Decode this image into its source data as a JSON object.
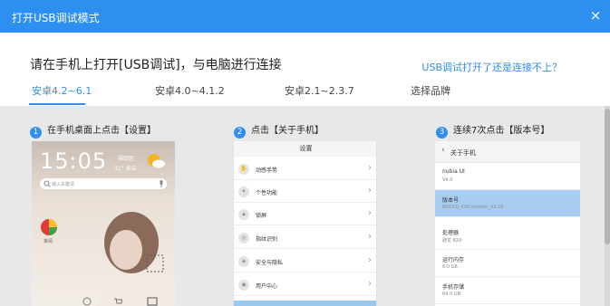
{
  "window": {
    "title": "打开USB调试模式",
    "close_symbol": "×"
  },
  "header": {
    "headline": "请在手机上打开[USB调试]，与电脑进行连接",
    "help_link": "USB调试打开了还是连接不上？"
  },
  "tabs": [
    {
      "label": "安卓4.2~6.1",
      "active": true
    },
    {
      "label": "安卓4.0~4.1.2",
      "active": false
    },
    {
      "label": "安卓2.1~2.3.7",
      "active": false
    },
    {
      "label": "选择品牌",
      "active": false
    }
  ],
  "steps": [
    {
      "num": "1",
      "text": "在手机桌面上点击【设置】"
    },
    {
      "num": "2",
      "text": "点击【关于手机】"
    },
    {
      "num": "3",
      "text": "连续7次点击【版本号】"
    }
  ],
  "phone1": {
    "time": "15:05",
    "city": "福田区",
    "weather": "31°  多云",
    "search_placeholder": "输入关键词",
    "app_label": "掌阅"
  },
  "phone2": {
    "header": "设置",
    "rows": [
      {
        "label": "动感手势"
      },
      {
        "label": "个性功能"
      },
      {
        "label": "锁屏"
      },
      {
        "label": "指纹识别"
      },
      {
        "label": "安全与隐私"
      },
      {
        "label": "用户中心"
      }
    ],
    "chevron": "›"
  },
  "phone3": {
    "back": "‹",
    "header": "关于手机",
    "rows": [
      {
        "key": "nubia UI",
        "value": "V4.0",
        "highlight": false
      },
      {
        "key": "版本号",
        "value": "NX531J_CNCommon_V2.10",
        "highlight": true
      },
      {
        "key": "处理器",
        "value": "骁龙 820",
        "highlight": false
      },
      {
        "key": "运行内存",
        "value": "6.0 GB",
        "highlight": false
      },
      {
        "key": "手机存储",
        "value": "64.0 GB",
        "highlight": false
      }
    ]
  },
  "colors": {
    "accent": "#2d8ff0",
    "content_bg": "#e7e8ea",
    "highlight": "#a9cdf0"
  }
}
